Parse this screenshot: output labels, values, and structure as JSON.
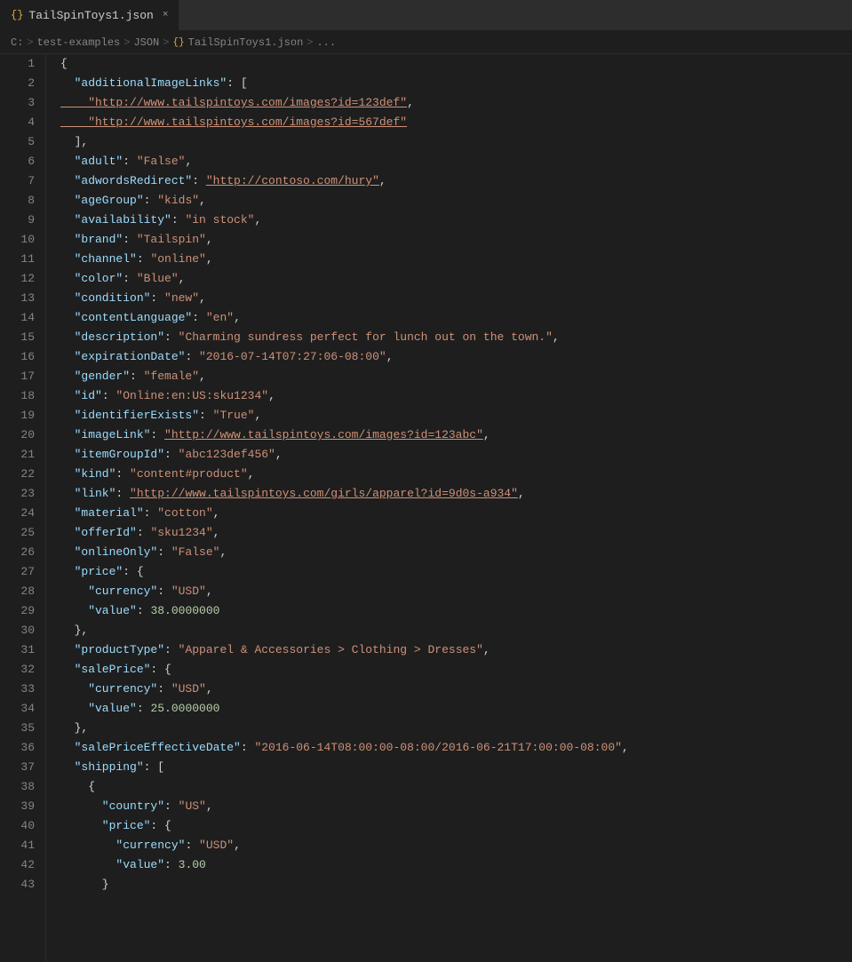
{
  "tab": {
    "icon": "{}",
    "label": "TailSpinToys1.json",
    "close": "×"
  },
  "breadcrumb": {
    "parts": [
      "C:",
      ">",
      "test-examples",
      ">",
      "JSON",
      ">",
      "{}",
      "TailSpinToys1.json",
      ">",
      "..."
    ]
  },
  "lines": [
    {
      "num": 1,
      "content": [
        {
          "t": "punct",
          "v": "{"
        }
      ]
    },
    {
      "num": 2,
      "content": [
        {
          "t": "key",
          "v": "  \"additionalImageLinks\""
        },
        {
          "t": "punct",
          "v": ": ["
        }
      ]
    },
    {
      "num": 3,
      "content": [
        {
          "t": "url",
          "v": "    \"http://www.tailspintoys.com/images?id=123def\""
        },
        {
          "t": "punct",
          "v": ","
        }
      ]
    },
    {
      "num": 4,
      "content": [
        {
          "t": "url",
          "v": "    \"http://www.tailspintoys.com/images?id=567def\""
        }
      ]
    },
    {
      "num": 5,
      "content": [
        {
          "t": "punct",
          "v": "  ],"
        }
      ]
    },
    {
      "num": 6,
      "content": [
        {
          "t": "key",
          "v": "  \"adult\""
        },
        {
          "t": "punct",
          "v": ": "
        },
        {
          "t": "string",
          "v": "\"False\""
        },
        {
          "t": "punct",
          "v": ","
        }
      ]
    },
    {
      "num": 7,
      "content": [
        {
          "t": "key",
          "v": "  \"adwordsRedirect\""
        },
        {
          "t": "punct",
          "v": ": "
        },
        {
          "t": "url",
          "v": "\"http://contoso.com/hury\""
        },
        {
          "t": "punct",
          "v": ","
        }
      ]
    },
    {
      "num": 8,
      "content": [
        {
          "t": "key",
          "v": "  \"ageGroup\""
        },
        {
          "t": "punct",
          "v": ": "
        },
        {
          "t": "string",
          "v": "\"kids\""
        },
        {
          "t": "punct",
          "v": ","
        }
      ]
    },
    {
      "num": 9,
      "content": [
        {
          "t": "key",
          "v": "  \"availability\""
        },
        {
          "t": "punct",
          "v": ": "
        },
        {
          "t": "string",
          "v": "\"in stock\""
        },
        {
          "t": "punct",
          "v": ","
        }
      ]
    },
    {
      "num": 10,
      "content": [
        {
          "t": "key",
          "v": "  \"brand\""
        },
        {
          "t": "punct",
          "v": ": "
        },
        {
          "t": "string",
          "v": "\"Tailspin\""
        },
        {
          "t": "punct",
          "v": ","
        }
      ]
    },
    {
      "num": 11,
      "content": [
        {
          "t": "key",
          "v": "  \"channel\""
        },
        {
          "t": "punct",
          "v": ": "
        },
        {
          "t": "string",
          "v": "\"online\""
        },
        {
          "t": "punct",
          "v": ","
        }
      ]
    },
    {
      "num": 12,
      "content": [
        {
          "t": "key",
          "v": "  \"color\""
        },
        {
          "t": "punct",
          "v": ": "
        },
        {
          "t": "string",
          "v": "\"Blue\""
        },
        {
          "t": "punct",
          "v": ","
        }
      ]
    },
    {
      "num": 13,
      "content": [
        {
          "t": "key",
          "v": "  \"condition\""
        },
        {
          "t": "punct",
          "v": ": "
        },
        {
          "t": "string",
          "v": "\"new\""
        },
        {
          "t": "punct",
          "v": ","
        }
      ]
    },
    {
      "num": 14,
      "content": [
        {
          "t": "key",
          "v": "  \"contentLanguage\""
        },
        {
          "t": "punct",
          "v": ": "
        },
        {
          "t": "string",
          "v": "\"en\""
        },
        {
          "t": "punct",
          "v": ","
        }
      ]
    },
    {
      "num": 15,
      "content": [
        {
          "t": "key",
          "v": "  \"description\""
        },
        {
          "t": "punct",
          "v": ": "
        },
        {
          "t": "string",
          "v": "\"Charming sundress perfect for lunch out on the town.\""
        },
        {
          "t": "punct",
          "v": ","
        }
      ]
    },
    {
      "num": 16,
      "content": [
        {
          "t": "key",
          "v": "  \"expirationDate\""
        },
        {
          "t": "punct",
          "v": ": "
        },
        {
          "t": "string",
          "v": "\"2016-07-14T07:27:06-08:00\""
        },
        {
          "t": "punct",
          "v": ","
        }
      ]
    },
    {
      "num": 17,
      "content": [
        {
          "t": "key",
          "v": "  \"gender\""
        },
        {
          "t": "punct",
          "v": ": "
        },
        {
          "t": "string",
          "v": "\"female\""
        },
        {
          "t": "punct",
          "v": ","
        }
      ]
    },
    {
      "num": 18,
      "content": [
        {
          "t": "key",
          "v": "  \"id\""
        },
        {
          "t": "punct",
          "v": ": "
        },
        {
          "t": "string",
          "v": "\"Online:en:US:sku1234\""
        },
        {
          "t": "punct",
          "v": ","
        }
      ]
    },
    {
      "num": 19,
      "content": [
        {
          "t": "key",
          "v": "  \"identifierExists\""
        },
        {
          "t": "punct",
          "v": ": "
        },
        {
          "t": "string",
          "v": "\"True\""
        },
        {
          "t": "punct",
          "v": ","
        }
      ]
    },
    {
      "num": 20,
      "content": [
        {
          "t": "key",
          "v": "  \"imageLink\""
        },
        {
          "t": "punct",
          "v": ": "
        },
        {
          "t": "url",
          "v": "\"http://www.tailspintoys.com/images?id=123abc\""
        },
        {
          "t": "punct",
          "v": ","
        }
      ]
    },
    {
      "num": 21,
      "content": [
        {
          "t": "key",
          "v": "  \"itemGroupId\""
        },
        {
          "t": "punct",
          "v": ": "
        },
        {
          "t": "string",
          "v": "\"abc123def456\""
        },
        {
          "t": "punct",
          "v": ","
        }
      ]
    },
    {
      "num": 22,
      "content": [
        {
          "t": "key",
          "v": "  \"kind\""
        },
        {
          "t": "punct",
          "v": ": "
        },
        {
          "t": "string",
          "v": "\"content#product\""
        },
        {
          "t": "punct",
          "v": ","
        }
      ]
    },
    {
      "num": 23,
      "content": [
        {
          "t": "key",
          "v": "  \"link\""
        },
        {
          "t": "punct",
          "v": ": "
        },
        {
          "t": "url",
          "v": "\"http://www.tailspintoys.com/girls/apparel?id=9d0s-a934\""
        },
        {
          "t": "punct",
          "v": ","
        }
      ]
    },
    {
      "num": 24,
      "content": [
        {
          "t": "key",
          "v": "  \"material\""
        },
        {
          "t": "punct",
          "v": ": "
        },
        {
          "t": "string",
          "v": "\"cotton\""
        },
        {
          "t": "punct",
          "v": ","
        }
      ]
    },
    {
      "num": 25,
      "content": [
        {
          "t": "key",
          "v": "  \"offerId\""
        },
        {
          "t": "punct",
          "v": ": "
        },
        {
          "t": "string",
          "v": "\"sku1234\""
        },
        {
          "t": "punct",
          "v": ","
        }
      ]
    },
    {
      "num": 26,
      "content": [
        {
          "t": "key",
          "v": "  \"onlineOnly\""
        },
        {
          "t": "punct",
          "v": ": "
        },
        {
          "t": "string",
          "v": "\"False\""
        },
        {
          "t": "punct",
          "v": ","
        }
      ]
    },
    {
      "num": 27,
      "content": [
        {
          "t": "key",
          "v": "  \"price\""
        },
        {
          "t": "punct",
          "v": ": {"
        }
      ]
    },
    {
      "num": 28,
      "content": [
        {
          "t": "key",
          "v": "    \"currency\""
        },
        {
          "t": "punct",
          "v": ": "
        },
        {
          "t": "string",
          "v": "\"USD\""
        },
        {
          "t": "punct",
          "v": ","
        }
      ]
    },
    {
      "num": 29,
      "content": [
        {
          "t": "key",
          "v": "    \"value\""
        },
        {
          "t": "punct",
          "v": ": "
        },
        {
          "t": "number",
          "v": "38.0000000"
        }
      ]
    },
    {
      "num": 30,
      "content": [
        {
          "t": "punct",
          "v": "  },"
        }
      ]
    },
    {
      "num": 31,
      "content": [
        {
          "t": "key",
          "v": "  \"productType\""
        },
        {
          "t": "punct",
          "v": ": "
        },
        {
          "t": "string",
          "v": "\"Apparel & Accessories > Clothing > Dresses\""
        },
        {
          "t": "punct",
          "v": ","
        }
      ]
    },
    {
      "num": 32,
      "content": [
        {
          "t": "key",
          "v": "  \"salePrice\""
        },
        {
          "t": "punct",
          "v": ": {"
        }
      ]
    },
    {
      "num": 33,
      "content": [
        {
          "t": "key",
          "v": "    \"currency\""
        },
        {
          "t": "punct",
          "v": ": "
        },
        {
          "t": "string",
          "v": "\"USD\""
        },
        {
          "t": "punct",
          "v": ","
        }
      ]
    },
    {
      "num": 34,
      "content": [
        {
          "t": "key",
          "v": "    \"value\""
        },
        {
          "t": "punct",
          "v": ": "
        },
        {
          "t": "number",
          "v": "25.0000000"
        }
      ]
    },
    {
      "num": 35,
      "content": [
        {
          "t": "punct",
          "v": "  },"
        }
      ]
    },
    {
      "num": 36,
      "content": [
        {
          "t": "key",
          "v": "  \"salePriceEffectiveDate\""
        },
        {
          "t": "punct",
          "v": ": "
        },
        {
          "t": "string",
          "v": "\"2016-06-14T08:00:00-08:00/2016-06-21T17:00:00-08:00\""
        },
        {
          "t": "punct",
          "v": ","
        }
      ]
    },
    {
      "num": 37,
      "content": [
        {
          "t": "key",
          "v": "  \"shipping\""
        },
        {
          "t": "punct",
          "v": ": ["
        }
      ]
    },
    {
      "num": 38,
      "content": [
        {
          "t": "punct",
          "v": "    {"
        }
      ]
    },
    {
      "num": 39,
      "content": [
        {
          "t": "key",
          "v": "      \"country\""
        },
        {
          "t": "punct",
          "v": ": "
        },
        {
          "t": "string",
          "v": "\"US\""
        },
        {
          "t": "punct",
          "v": ","
        }
      ]
    },
    {
      "num": 40,
      "content": [
        {
          "t": "key",
          "v": "      \"price\""
        },
        {
          "t": "punct",
          "v": ": {"
        }
      ]
    },
    {
      "num": 41,
      "content": [
        {
          "t": "key",
          "v": "        \"currency\""
        },
        {
          "t": "punct",
          "v": ": "
        },
        {
          "t": "string",
          "v": "\"USD\""
        },
        {
          "t": "punct",
          "v": ","
        }
      ]
    },
    {
      "num": 42,
      "content": [
        {
          "t": "key",
          "v": "        \"value\""
        },
        {
          "t": "punct",
          "v": ": "
        },
        {
          "t": "number",
          "v": "3.00"
        }
      ]
    },
    {
      "num": 43,
      "content": [
        {
          "t": "punct",
          "v": "      }"
        }
      ]
    }
  ]
}
